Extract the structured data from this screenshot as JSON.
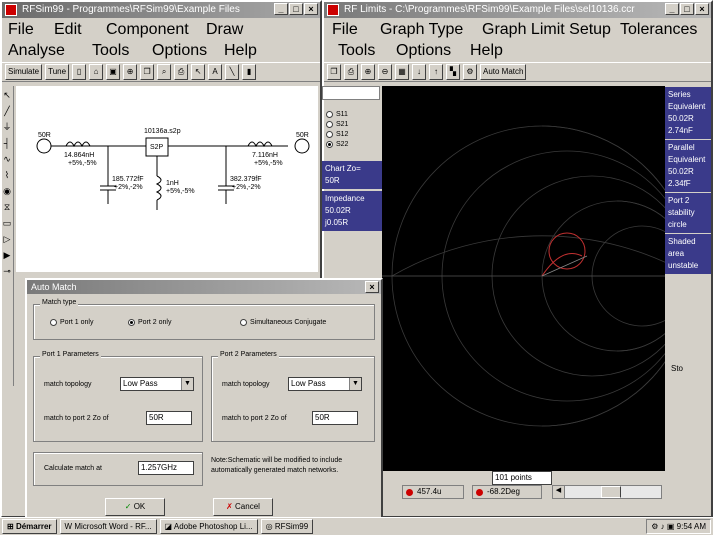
{
  "left_window": {
    "title": "RFSim99 - Programmes\\RFSim99\\Example Files",
    "menu": [
      "File",
      "Edit",
      "Component",
      "Draw",
      "Analyse",
      "Tools",
      "Options",
      "Help"
    ],
    "toolbar": {
      "simulate": "Simulate",
      "tune": "Tune"
    },
    "schematic": {
      "port1": "50R",
      "port2": "50R",
      "l1": "14.864nH",
      "l1_tol": "+5%,-5%",
      "c1": "185.772fF",
      "c1_tol": "+2%,-2%",
      "part": "10136a.s2p",
      "part_label": "S2P",
      "l2": "1nH",
      "l2_tol": "+5%,-5%",
      "l3": "7.116nH",
      "l3_tol": "+5%,-5%",
      "c2": "382.379fF",
      "c2_tol": "+2%,-2%"
    }
  },
  "right_window": {
    "title": "RF Limits - C:\\Programmes\\RFSim99\\Example Files\\sel10136.ccr",
    "menu": [
      "File",
      "Graph Type",
      "Graph Limit Setup",
      "Tolerances",
      "Tools",
      "Options",
      "Help"
    ],
    "toolbar": {
      "auto_match": "Auto Match"
    },
    "s_params": [
      {
        "label": "S11",
        "selected": false
      },
      {
        "label": "S21",
        "selected": false
      },
      {
        "label": "S12",
        "selected": false
      },
      {
        "label": "S22",
        "selected": true
      }
    ],
    "chart_zo_label": "Chart Zo=",
    "chart_zo_value": "50R",
    "impedance_label": "Impedance",
    "impedance_values": [
      "50.02R",
      "j0.05R"
    ],
    "right_info": [
      {
        "title": "Series Equivalent",
        "values": [
          "50.02R",
          "2.74nF"
        ]
      },
      {
        "title": "Parallel Equivalent",
        "values": [
          "50.02R",
          "2.34fF"
        ]
      },
      {
        "title": "Port 2 stability circle",
        "values": []
      },
      {
        "title": "Shaded area unstable",
        "values": []
      }
    ],
    "points": "101 points",
    "status_mag": "457.4u",
    "status_phase": "-68.2Deg",
    "stop_label": "Sto"
  },
  "auto_match": {
    "title": "Auto Match",
    "match_type_label": "Match type",
    "match_options": [
      {
        "label": "Port 1 only",
        "selected": false
      },
      {
        "label": "Port 2 only",
        "selected": true
      },
      {
        "label": "Simultaneous Conjugate",
        "selected": false
      }
    ],
    "port1": {
      "group": "Port 1 Parameters",
      "topology_label": "match topology",
      "topology": "Low Pass",
      "zo_label": "match to port 2 Zo of",
      "zo": "50R"
    },
    "port2": {
      "group": "Port 2 Parameters",
      "topology_label": "match topology",
      "topology": "Low Pass",
      "zo_label": "match to port 2 Zo of",
      "zo": "50R"
    },
    "calc_label": "Calculate match at",
    "calc_value": "1.257GHz",
    "note": "Note:Schematic will be modified to include automatically generated match networks.",
    "ok": "OK",
    "cancel": "Cancel"
  },
  "taskbar": {
    "start": "Démarrer",
    "tasks": [
      "Microsoft Word - RF...",
      "Adobe Photoshop Li...",
      "RFSim99"
    ],
    "clock": "9:54 AM"
  }
}
